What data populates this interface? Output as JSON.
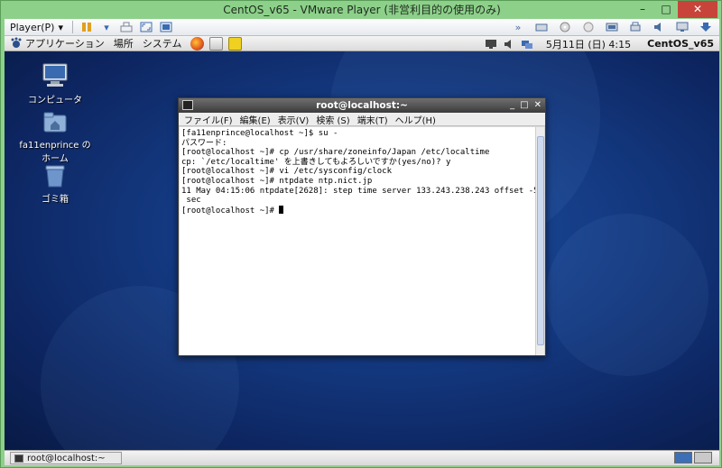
{
  "window": {
    "title": "CentOS_v65 - VMware Player (非営利目的の使用のみ)",
    "minimize": "–",
    "maximize": "□",
    "close": "✕"
  },
  "toolbar": {
    "player_menu": "Player(P)"
  },
  "panel": {
    "menus": [
      "アプリケーション",
      "場所",
      "システム"
    ],
    "clock": "5月11日 (日)  4:15",
    "hostname": "CentOS_v65"
  },
  "desktop": {
    "icons": [
      {
        "label": "コンピュータ"
      },
      {
        "label": "fa11enprince のホーム"
      },
      {
        "label": "ゴミ箱"
      }
    ]
  },
  "terminal": {
    "title": "root@localhost:~",
    "menu": [
      "ファイル(F)",
      "編集(E)",
      "表示(V)",
      "検索 (S)",
      "端末(T)",
      "ヘルプ(H)"
    ],
    "lines": [
      "[fa11enprince@localhost ~]$ su -",
      "パスワード:",
      "[root@localhost ~]# cp /usr/share/zoneinfo/Japan /etc/localtime",
      "cp: `/etc/localtime' を上書きしてもよろしいですか(yes/no)? y",
      "[root@localhost ~]# vi /etc/sysconfig/clock",
      "[root@localhost ~]# ntpdate ntp.nict.jp",
      "11 May 04:15:06 ntpdate[2628]: step time server 133.243.238.243 offset -5.040664",
      " sec"
    ],
    "prompt": "[root@localhost ~]# "
  },
  "taskbar": {
    "task_label": "root@localhost:~"
  }
}
